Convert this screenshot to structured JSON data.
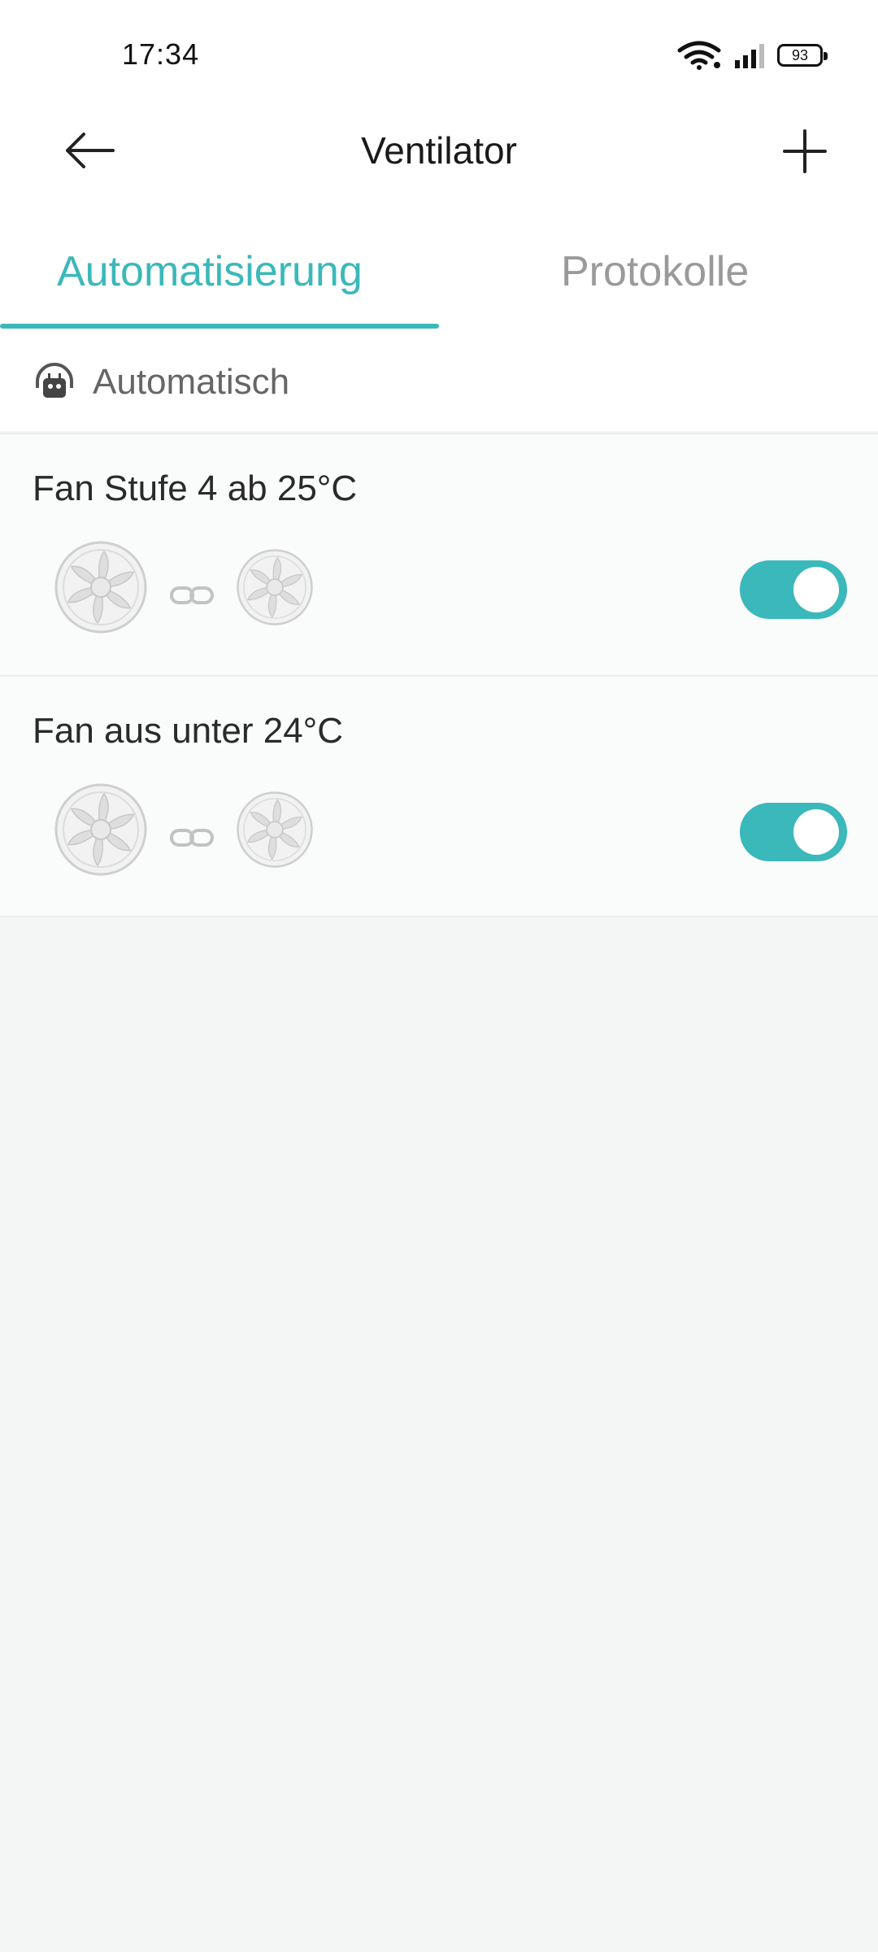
{
  "status_bar": {
    "time": "17:34",
    "battery": "93"
  },
  "header": {
    "title": "Ventilator"
  },
  "tabs": [
    {
      "label": "Automatisierung",
      "active": true
    },
    {
      "label": "Protokolle",
      "active": false
    }
  ],
  "section": {
    "label": "Automatisch",
    "icon": "robot-icon"
  },
  "automations": [
    {
      "title": "Fan Stufe 4 ab 25°C",
      "enabled": true
    },
    {
      "title": "Fan aus unter 24°C",
      "enabled": true
    }
  ],
  "colors": {
    "accent": "#3bb8ba",
    "background": "#f4f5f5"
  }
}
